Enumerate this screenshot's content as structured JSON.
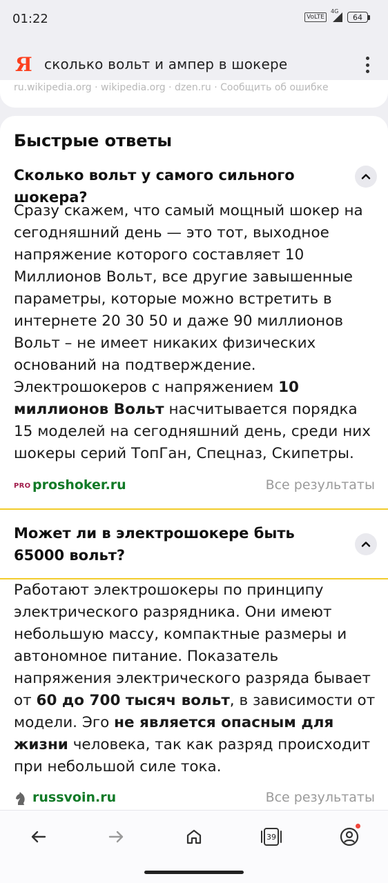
{
  "status": {
    "time": "01:22",
    "network": "VoLTE",
    "signal_label": "4G",
    "battery": "64"
  },
  "search": {
    "logo": "Я",
    "query": "сколько вольт и ампер в шокере"
  },
  "previous_card": {
    "sources_text": "ru.wikipedia.org  ·  wikipedia.org  ·  dzen.ru  ·  Сообщить об ошибке"
  },
  "quick_answers": {
    "title": "Быстрые ответы",
    "items": [
      {
        "question": "Сколько вольт у самого сильного шокера?",
        "answer_1": "Сразу скажем, что самый мощный шокер на сегодняшний день — это тот, выходное напряжение которого составляет 10 Миллионов Вольт, все другие завышенные параметры, которые можно встретить в интернете 20  30  50 и даже 90 миллионов Вольт – не имеет никаких физических оснований на подтверждение. Электрошокеров с напряжением ",
        "answer_bold_1": "10 миллионов Вольт",
        "answer_2": " насчитывается порядка 15 моделей на сегодняшний день, среди них шокеры серий ТопГан, Спецназ, Скипетры.",
        "source_badge": "PRO",
        "source": "proshoker.ru",
        "all_results": "Все результаты"
      },
      {
        "question": "Может ли в электрошокере быть 65000 вольт?",
        "answer_1": "Работают электрошокеры по принципу электрического разрядника. Они имеют небольшую массу, компактные размеры и автономное питание. Показатель напряжения электрического разряда бывает от ",
        "answer_bold_1": "60 до 700 тысяч вольт",
        "answer_2": ", в зависимости от модели. Эго ",
        "answer_bold_2": "не является опасным для жизни",
        "answer_3": " человека, так как разряд происходит при небольшой силе тока.",
        "source": "russvoin.ru",
        "all_results": "Все результаты"
      }
    ]
  },
  "nav": {
    "tabs_count": "39"
  },
  "colors": {
    "accent_yellow": "#f2cc2b",
    "source_green": "#117a27",
    "yandex_red": "#fc3f1d",
    "notification_dot": "#f0463c"
  },
  "icons": [
    "back-arrow-icon",
    "forward-arrow-icon",
    "home-icon",
    "tabs-icon",
    "profile-icon",
    "chevron-up-icon",
    "kebab-menu-icon",
    "knight-icon"
  ]
}
